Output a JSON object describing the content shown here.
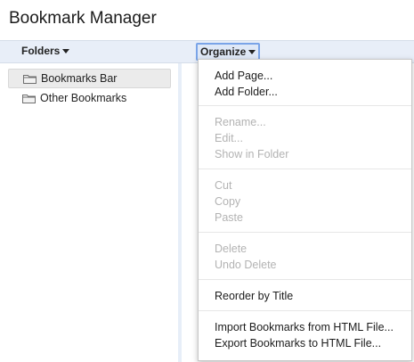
{
  "app": {
    "title": "Bookmark Manager"
  },
  "toolbar": {
    "folders_label": "Folders",
    "organize_label": "Organize"
  },
  "sidebar": {
    "items": [
      {
        "label": "Bookmarks Bar",
        "icon": "folder-icon",
        "selected": true
      },
      {
        "label": "Other Bookmarks",
        "icon": "folder-icon",
        "selected": false
      }
    ]
  },
  "organize_menu": {
    "add_page": "Add Page...",
    "add_folder": "Add Folder...",
    "rename": "Rename...",
    "edit": "Edit...",
    "show_in_folder": "Show in Folder",
    "cut": "Cut",
    "copy": "Copy",
    "paste": "Paste",
    "delete": "Delete",
    "undo_delete": "Undo Delete",
    "reorder_by_title": "Reorder by Title",
    "import_html": "Import Bookmarks from HTML File...",
    "export_html": "Export Bookmarks to HTML File..."
  },
  "colors": {
    "toolbar_bg": "#e8eef8",
    "focus_ring": "#7aa4e8",
    "disabled_text": "#b3b3b3"
  }
}
